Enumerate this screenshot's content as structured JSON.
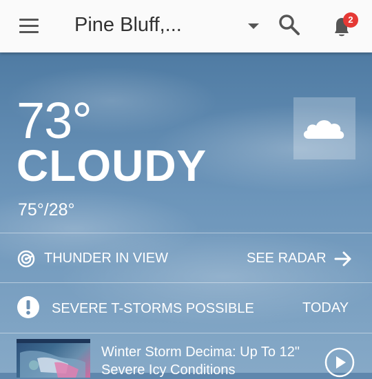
{
  "header": {
    "location": "Pine Bluff,...",
    "notification_count": "2"
  },
  "current": {
    "temperature": "73°",
    "condition": "CLOUDY",
    "hi_lo": "75°/28°"
  },
  "radar_row": {
    "label": "THUNDER IN VIEW",
    "action": "SEE RADAR"
  },
  "alert_row": {
    "label": "SEVERE T-STORMS POSSIBLE",
    "when": "TODAY"
  },
  "news": {
    "headline": "Winter Storm Decima: Up To 12\" Severe Icy Conditions"
  },
  "colors": {
    "badge": "#e53935",
    "topbar": "#fafafa"
  }
}
